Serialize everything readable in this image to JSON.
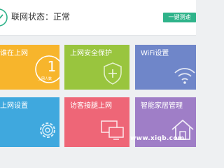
{
  "status": {
    "label": "联网状态：正常",
    "icon": "check-circle-icon",
    "color": "#2fb38a"
  },
  "toolbar": {
    "onekey_label": "一键测速"
  },
  "tiles": {
    "online": {
      "label": "谁在上网",
      "count": "1",
      "sub": "上网人数",
      "color": "#f7b52c"
    },
    "security": {
      "label": "上网安全保护",
      "icon": "shield-plus-icon",
      "color": "#99c53e"
    },
    "wifi": {
      "label": "WiFi设置",
      "icon": "wifi-icon",
      "color": "#6f86c9"
    },
    "net": {
      "label": "上网设置",
      "icon": "gear-icon",
      "color": "#3fa8de"
    },
    "guest": {
      "label": "访客接腿上网",
      "icon": "devices-icon",
      "color": "#ee6677"
    },
    "smart": {
      "label": "智能家居管理",
      "icon": "house-icon",
      "color": "#9f7ec7"
    }
  },
  "watermark": "www.xiqb.com"
}
